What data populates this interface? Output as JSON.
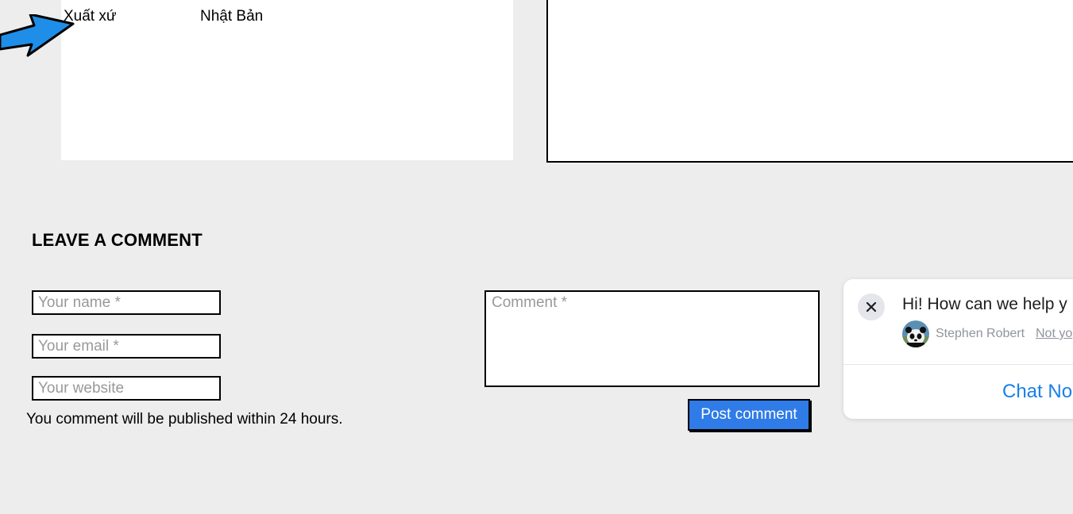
{
  "spec": {
    "rows": [
      {
        "key": "Xuất xứ",
        "value": "Nhật Bản"
      }
    ]
  },
  "comment_form": {
    "title": "LEAVE A COMMENT",
    "name_placeholder": "Your name *",
    "email_placeholder": "Your email *",
    "website_placeholder": "Your website",
    "comment_placeholder": "Comment *",
    "note": "You comment will be published within 24 hours.",
    "submit_label": "Post comment"
  },
  "chat": {
    "greeting": "Hi! How can we help y",
    "user_name": "Stephen Robert",
    "not_you": "Not yo",
    "cta_label": "Chat No",
    "colors": {
      "cta": "#1a7fe6"
    }
  },
  "colors": {
    "background": "#ededed",
    "button": "#2f7be8",
    "arrow": "#1e8ee8"
  },
  "icons": {
    "pointer_arrow": "arrow-right-icon",
    "close": "close-icon",
    "avatar": "panda-avatar"
  }
}
